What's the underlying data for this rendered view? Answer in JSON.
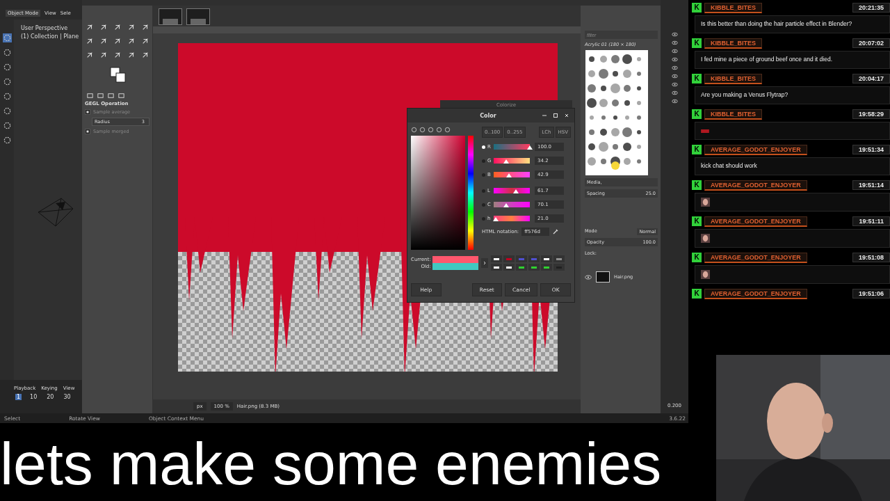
{
  "blender": {
    "mode": "Object Mode",
    "menu": [
      "View",
      "Sele"
    ],
    "viewport_info": [
      "User Perspective",
      "(1) Collection | Plane"
    ],
    "timeline_menu": [
      "Playback",
      "Keying",
      "View"
    ],
    "frames": [
      {
        "label": "1",
        "selected": true
      },
      {
        "label": "10",
        "selected": false
      },
      {
        "label": "20",
        "selected": false
      },
      {
        "label": "30",
        "selected": false
      }
    ],
    "status": [
      "Select",
      "Rotate View",
      "Object Context Menu"
    ],
    "version": "3.6.22",
    "outliner_value": "0.200"
  },
  "gimp": {
    "tool_options": {
      "title": "GEGL Operation",
      "options": [
        {
          "kind": "check",
          "label": "Sample average",
          "checked": true
        },
        {
          "kind": "spin",
          "label": "Radius",
          "value": "3"
        },
        {
          "kind": "check",
          "label": "Sample merged",
          "checked": true
        }
      ]
    },
    "status": {
      "unit": "px",
      "zoom": "100 %",
      "file": "Hair.png (8.3 MB)"
    },
    "brushes": {
      "filter_placeholder": "filter",
      "name": "Acrylic 01 (180 × 180)",
      "tag": "Media,",
      "spacing_label": "Spacing",
      "spacing": "25.0"
    },
    "layers": {
      "mode_label": "Mode",
      "mode": "Normal",
      "opacity_label": "Opacity",
      "opacity": "100.0",
      "lock_label": "Lock:",
      "items": [
        {
          "name": "Hair.png",
          "visible": true
        }
      ]
    },
    "background_dialog": {
      "title": "Colorize"
    },
    "color_dialog": {
      "title": "Color",
      "range_buttons": [
        "0..100",
        "0..255"
      ],
      "model_buttons": [
        "LCh",
        "HSV"
      ],
      "channels": [
        {
          "name": "R",
          "selected": true,
          "level": 1.0,
          "value": "100.0"
        },
        {
          "name": "G",
          "selected": false,
          "level": 0.342,
          "value": "34.2"
        },
        {
          "name": "B",
          "selected": false,
          "level": 0.429,
          "value": "42.9"
        },
        {
          "name": "L",
          "selected": false,
          "level": 0.617,
          "value": "61.7"
        },
        {
          "name": "C",
          "selected": false,
          "level": 0.35,
          "value": "70.1"
        },
        {
          "name": "h",
          "selected": false,
          "level": 0.06,
          "value": "21.0"
        }
      ],
      "html_label": "HTML notation:",
      "html_value": "ff576d",
      "current": {
        "label": "Current:",
        "color": "#ff576d"
      },
      "old": {
        "label": "Old:",
        "color": "#40c8c0"
      },
      "history": [
        {
          "color": "#ffffff"
        },
        {
          "color": "#c00020"
        },
        {
          "color": "#5050d0"
        },
        {
          "color": "#5050d0"
        },
        {
          "color": "#ffffff"
        },
        {
          "color": "#909090"
        },
        {
          "color": "#ffffff"
        },
        {
          "color": "#ffffff"
        },
        {
          "color": "#30d030"
        },
        {
          "color": "#30d030"
        },
        {
          "color": "#30d030"
        },
        {
          "color": "#202020"
        }
      ],
      "buttons": [
        "Help",
        "Reset",
        "Cancel",
        "OK"
      ]
    }
  },
  "chat": [
    {
      "badge": "K",
      "user": "KIBBLE_BITES",
      "time": "20:21:35",
      "kind": "text",
      "text": "Is this better than doing the hair particle effect in Blender?"
    },
    {
      "badge": "K",
      "user": "KIBBLE_BITES",
      "time": "20:07:02",
      "kind": "text",
      "text": "I fed mine a piece of ground beef once and it died."
    },
    {
      "badge": "K",
      "user": "KIBBLE_BITES",
      "time": "20:04:17",
      "kind": "text",
      "text": "Are you making a Venus Flytrap?"
    },
    {
      "badge": "K",
      "user": "KIBBLE_BITES",
      "time": "19:58:29",
      "kind": "sticker"
    },
    {
      "badge": "K",
      "user": "AVERAGE_GODOT_ENJOYER",
      "time": "19:51:34",
      "kind": "text",
      "text": "kick chat should work"
    },
    {
      "badge": "K",
      "user": "AVERAGE_GODOT_ENJOYER",
      "time": "19:51:14",
      "kind": "emote"
    },
    {
      "badge": "K",
      "user": "AVERAGE_GODOT_ENJOYER",
      "time": "19:51:11",
      "kind": "emote"
    },
    {
      "badge": "K",
      "user": "AVERAGE_GODOT_ENJOYER",
      "time": "19:51:08",
      "kind": "emote"
    },
    {
      "badge": "K",
      "user": "AVERAGE_GODOT_ENJOYER",
      "time": "19:51:06",
      "kind": "cut"
    }
  ],
  "caption": "lets make some enemies"
}
